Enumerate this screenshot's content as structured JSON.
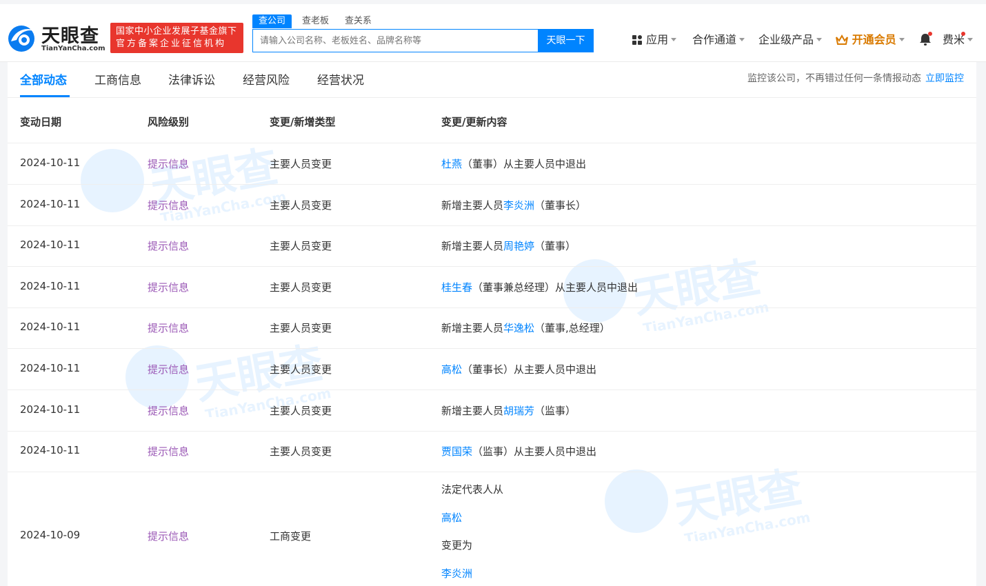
{
  "header": {
    "logo_text": "天眼查",
    "logo_sub": "TianYanCha.com",
    "badge_line1": "国家中小企业发展子基金旗下",
    "badge_line2": "官方备案企业征信机构",
    "search_tabs": [
      "查公司",
      "查老板",
      "查关系"
    ],
    "search_placeholder": "请输入公司名称、老板姓名、品牌名称等",
    "search_button": "天眼一下",
    "nav": {
      "apps": "应用",
      "partner": "合作通道",
      "enterprise": "企业级产品",
      "vip": "开通会员",
      "user": "费米"
    }
  },
  "tabs": [
    "全部动态",
    "工商信息",
    "法律诉讼",
    "经营风险",
    "经营状况"
  ],
  "monitor": {
    "text": "监控该公司，不再错过任何一条情报动态",
    "link": "立即监控"
  },
  "table": {
    "headers": [
      "变动日期",
      "风险级别",
      "变更/新增类型",
      "变更/更新内容"
    ],
    "rows": [
      {
        "date": "2024-10-11",
        "risk": "提示信息",
        "type": "主要人员变更",
        "pre": "",
        "name": "杜燕",
        "post": "（董事）从主要人员中退出"
      },
      {
        "date": "2024-10-11",
        "risk": "提示信息",
        "type": "主要人员变更",
        "pre": "新增主要人员",
        "name": "李炎洲",
        "post": "（董事长）"
      },
      {
        "date": "2024-10-11",
        "risk": "提示信息",
        "type": "主要人员变更",
        "pre": "新增主要人员",
        "name": "周艳婷",
        "post": "（董事）"
      },
      {
        "date": "2024-10-11",
        "risk": "提示信息",
        "type": "主要人员变更",
        "pre": "",
        "name": "桂生春",
        "post": "（董事兼总经理）从主要人员中退出"
      },
      {
        "date": "2024-10-11",
        "risk": "提示信息",
        "type": "主要人员变更",
        "pre": "新增主要人员",
        "name": "华逸松",
        "post": "（董事,总经理）"
      },
      {
        "date": "2024-10-11",
        "risk": "提示信息",
        "type": "主要人员变更",
        "pre": "",
        "name": "高松",
        "post": "（董事长）从主要人员中退出"
      },
      {
        "date": "2024-10-11",
        "risk": "提示信息",
        "type": "主要人员变更",
        "pre": "新增主要人员",
        "name": "胡瑞芳",
        "post": "（监事）"
      },
      {
        "date": "2024-10-11",
        "risk": "提示信息",
        "type": "主要人员变更",
        "pre": "",
        "name": "贾国荣",
        "post": "（监事）从主要人员中退出"
      }
    ],
    "last_row": {
      "date": "2024-10-09",
      "risk": "提示信息",
      "type": "工商变更",
      "line1": "法定代表人从",
      "from_name": "高松",
      "line3": "变更为",
      "to_name": "李炎洲"
    }
  },
  "watermark": {
    "main": "天眼查",
    "sub": "TianYanCha.com"
  },
  "colors": {
    "accent": "#0084ff",
    "risk": "#9b59b6",
    "badge": "#e8362d",
    "vip": "#d97a00"
  }
}
